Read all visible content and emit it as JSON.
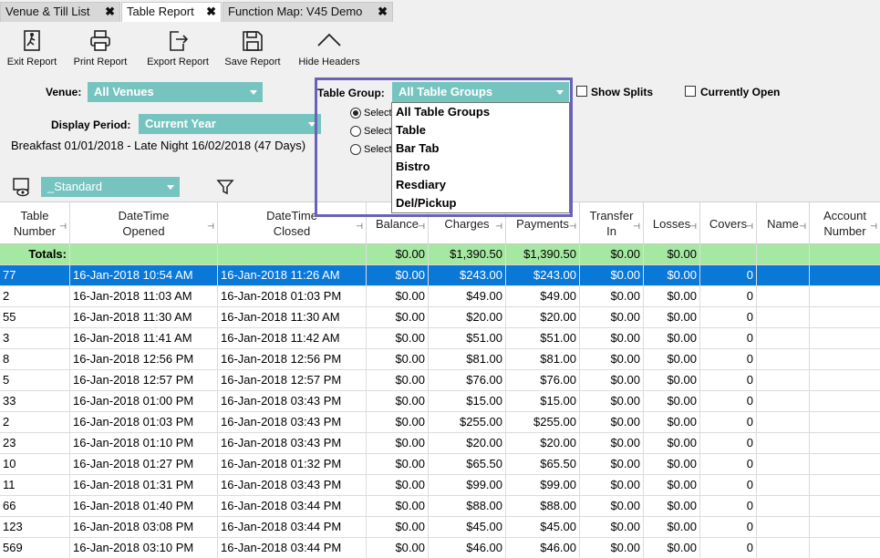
{
  "tabs": [
    {
      "label": "Venue & Till List",
      "close": "✖"
    },
    {
      "label": "Table Report",
      "close": "✖"
    },
    {
      "label": "Function Map: V45 Demo",
      "close": "✖"
    }
  ],
  "toolbar": {
    "exit": "Exit Report",
    "print": "Print Report",
    "export": "Export Report",
    "save": "Save Report",
    "hide": "Hide Headers"
  },
  "filters": {
    "venue_label": "Venue:",
    "venue_value": "All Venues",
    "period_label": "Display Period:",
    "period_value": "Current Year",
    "period_text": "Breakfast 01/01/2018 - Late Night 16/02/2018 (47 Days)",
    "table_group_label": "Table Group:",
    "table_group_value": "All Table Groups",
    "show_splits": "Show Splits",
    "currently_open": "Currently Open",
    "radio_labels": [
      "Select",
      "Select",
      "Select"
    ],
    "layout_value": "_Standard"
  },
  "dropdown": {
    "options": [
      "All Table Groups",
      "Table",
      "Bar Tab",
      "Bistro",
      "Resdiary",
      "Del/Pickup"
    ]
  },
  "table": {
    "headers": {
      "table_number": "Table Number",
      "opened": "DateTime Opened",
      "closed": "DateTime Closed",
      "balance": "Balance",
      "charges": "Charges",
      "payments": "Payments",
      "transfer_in": "Transfer In",
      "losses": "Losses",
      "covers": "Covers",
      "name": "Name",
      "account_number": "Account Number"
    },
    "totals": {
      "label": "Totals:",
      "balance": "$0.00",
      "charges": "$1,390.50",
      "payments": "$1,390.50",
      "transfer_in": "$0.00",
      "losses": "$0.00"
    },
    "rows": [
      [
        "77",
        "16-Jan-2018 10:54 AM",
        "16-Jan-2018 11:26 AM",
        "$0.00",
        "$243.00",
        "$243.00",
        "$0.00",
        "$0.00",
        "0"
      ],
      [
        "2",
        "16-Jan-2018 11:03 AM",
        "16-Jan-2018 01:03 PM",
        "$0.00",
        "$49.00",
        "$49.00",
        "$0.00",
        "$0.00",
        "0"
      ],
      [
        "55",
        "16-Jan-2018 11:30 AM",
        "16-Jan-2018 11:30 AM",
        "$0.00",
        "$20.00",
        "$20.00",
        "$0.00",
        "$0.00",
        "0"
      ],
      [
        "3",
        "16-Jan-2018 11:41 AM",
        "16-Jan-2018 11:42 AM",
        "$0.00",
        "$51.00",
        "$51.00",
        "$0.00",
        "$0.00",
        "0"
      ],
      [
        "8",
        "16-Jan-2018 12:56 PM",
        "16-Jan-2018 12:56 PM",
        "$0.00",
        "$81.00",
        "$81.00",
        "$0.00",
        "$0.00",
        "0"
      ],
      [
        "5",
        "16-Jan-2018 12:57 PM",
        "16-Jan-2018 12:57 PM",
        "$0.00",
        "$76.00",
        "$76.00",
        "$0.00",
        "$0.00",
        "0"
      ],
      [
        "33",
        "16-Jan-2018 01:00 PM",
        "16-Jan-2018 03:43 PM",
        "$0.00",
        "$15.00",
        "$15.00",
        "$0.00",
        "$0.00",
        "0"
      ],
      [
        "2",
        "16-Jan-2018 01:03 PM",
        "16-Jan-2018 03:43 PM",
        "$0.00",
        "$255.00",
        "$255.00",
        "$0.00",
        "$0.00",
        "0"
      ],
      [
        "23",
        "16-Jan-2018 01:10 PM",
        "16-Jan-2018 03:43 PM",
        "$0.00",
        "$20.00",
        "$20.00",
        "$0.00",
        "$0.00",
        "0"
      ],
      [
        "10",
        "16-Jan-2018 01:27 PM",
        "16-Jan-2018 01:32 PM",
        "$0.00",
        "$65.50",
        "$65.50",
        "$0.00",
        "$0.00",
        "0"
      ],
      [
        "11",
        "16-Jan-2018 01:31 PM",
        "16-Jan-2018 03:43 PM",
        "$0.00",
        "$99.00",
        "$99.00",
        "$0.00",
        "$0.00",
        "0"
      ],
      [
        "66",
        "16-Jan-2018 01:40 PM",
        "16-Jan-2018 03:44 PM",
        "$0.00",
        "$88.00",
        "$88.00",
        "$0.00",
        "$0.00",
        "0"
      ],
      [
        "123",
        "16-Jan-2018 03:08 PM",
        "16-Jan-2018 03:44 PM",
        "$0.00",
        "$45.00",
        "$45.00",
        "$0.00",
        "$0.00",
        "0"
      ],
      [
        "569",
        "16-Jan-2018 03:10 PM",
        "16-Jan-2018 03:44 PM",
        "$0.00",
        "$46.00",
        "$46.00",
        "$0.00",
        "$0.00",
        "0"
      ]
    ]
  },
  "colors": {
    "accent_combo": "#76c4c0",
    "totals_row": "#a5e8a2",
    "selected_row": "#0a78d7",
    "highlight_border": "#6a62b8"
  }
}
